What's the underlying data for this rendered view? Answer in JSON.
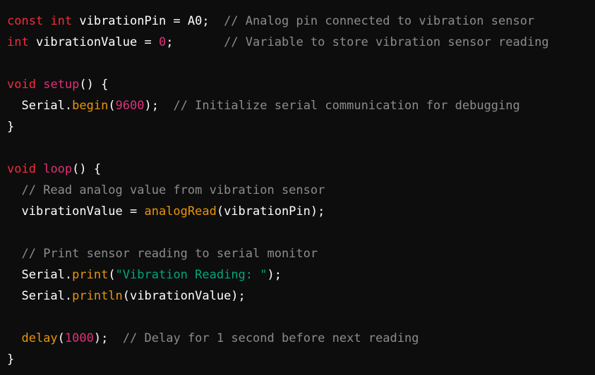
{
  "colors": {
    "background": "#0d0d0d",
    "keyword": "#f22c3d",
    "function": "#df3079",
    "call": "#e9950c",
    "number": "#df3079",
    "string": "#00a67d",
    "comment": "#8c8c8c",
    "plain": "#ffffff"
  },
  "lines": [
    [
      {
        "t": "kw",
        "v": "const int"
      },
      {
        "t": "plain",
        "v": " vibrationPin = A0;  "
      },
      {
        "t": "cmt",
        "v": "// Analog pin connected to vibration sensor"
      }
    ],
    [
      {
        "t": "kw",
        "v": "int"
      },
      {
        "t": "plain",
        "v": " vibrationValue = "
      },
      {
        "t": "num",
        "v": "0"
      },
      {
        "t": "plain",
        "v": ";       "
      },
      {
        "t": "cmt",
        "v": "// Variable to store vibration sensor reading"
      }
    ],
    [],
    [
      {
        "t": "kw",
        "v": "void"
      },
      {
        "t": "plain",
        "v": " "
      },
      {
        "t": "fn",
        "v": "setup"
      },
      {
        "t": "plain",
        "v": "() {"
      }
    ],
    [
      {
        "t": "plain",
        "v": "  Serial."
      },
      {
        "t": "call",
        "v": "begin"
      },
      {
        "t": "plain",
        "v": "("
      },
      {
        "t": "num",
        "v": "9600"
      },
      {
        "t": "plain",
        "v": ");  "
      },
      {
        "t": "cmt",
        "v": "// Initialize serial communication for debugging"
      }
    ],
    [
      {
        "t": "plain",
        "v": "}"
      }
    ],
    [],
    [
      {
        "t": "kw",
        "v": "void"
      },
      {
        "t": "plain",
        "v": " "
      },
      {
        "t": "fn",
        "v": "loop"
      },
      {
        "t": "plain",
        "v": "() {"
      }
    ],
    [
      {
        "t": "plain",
        "v": "  "
      },
      {
        "t": "cmt",
        "v": "// Read analog value from vibration sensor"
      }
    ],
    [
      {
        "t": "plain",
        "v": "  vibrationValue = "
      },
      {
        "t": "call",
        "v": "analogRead"
      },
      {
        "t": "plain",
        "v": "(vibrationPin);"
      }
    ],
    [],
    [
      {
        "t": "plain",
        "v": "  "
      },
      {
        "t": "cmt",
        "v": "// Print sensor reading to serial monitor"
      }
    ],
    [
      {
        "t": "plain",
        "v": "  Serial."
      },
      {
        "t": "call",
        "v": "print"
      },
      {
        "t": "plain",
        "v": "("
      },
      {
        "t": "str",
        "v": "\"Vibration Reading: \""
      },
      {
        "t": "plain",
        "v": ");"
      }
    ],
    [
      {
        "t": "plain",
        "v": "  Serial."
      },
      {
        "t": "call",
        "v": "println"
      },
      {
        "t": "plain",
        "v": "(vibrationValue);"
      }
    ],
    [],
    [
      {
        "t": "plain",
        "v": "  "
      },
      {
        "t": "call",
        "v": "delay"
      },
      {
        "t": "plain",
        "v": "("
      },
      {
        "t": "num",
        "v": "1000"
      },
      {
        "t": "plain",
        "v": ");  "
      },
      {
        "t": "cmt",
        "v": "// Delay for 1 second before next reading"
      }
    ],
    [
      {
        "t": "plain",
        "v": "}"
      }
    ]
  ]
}
